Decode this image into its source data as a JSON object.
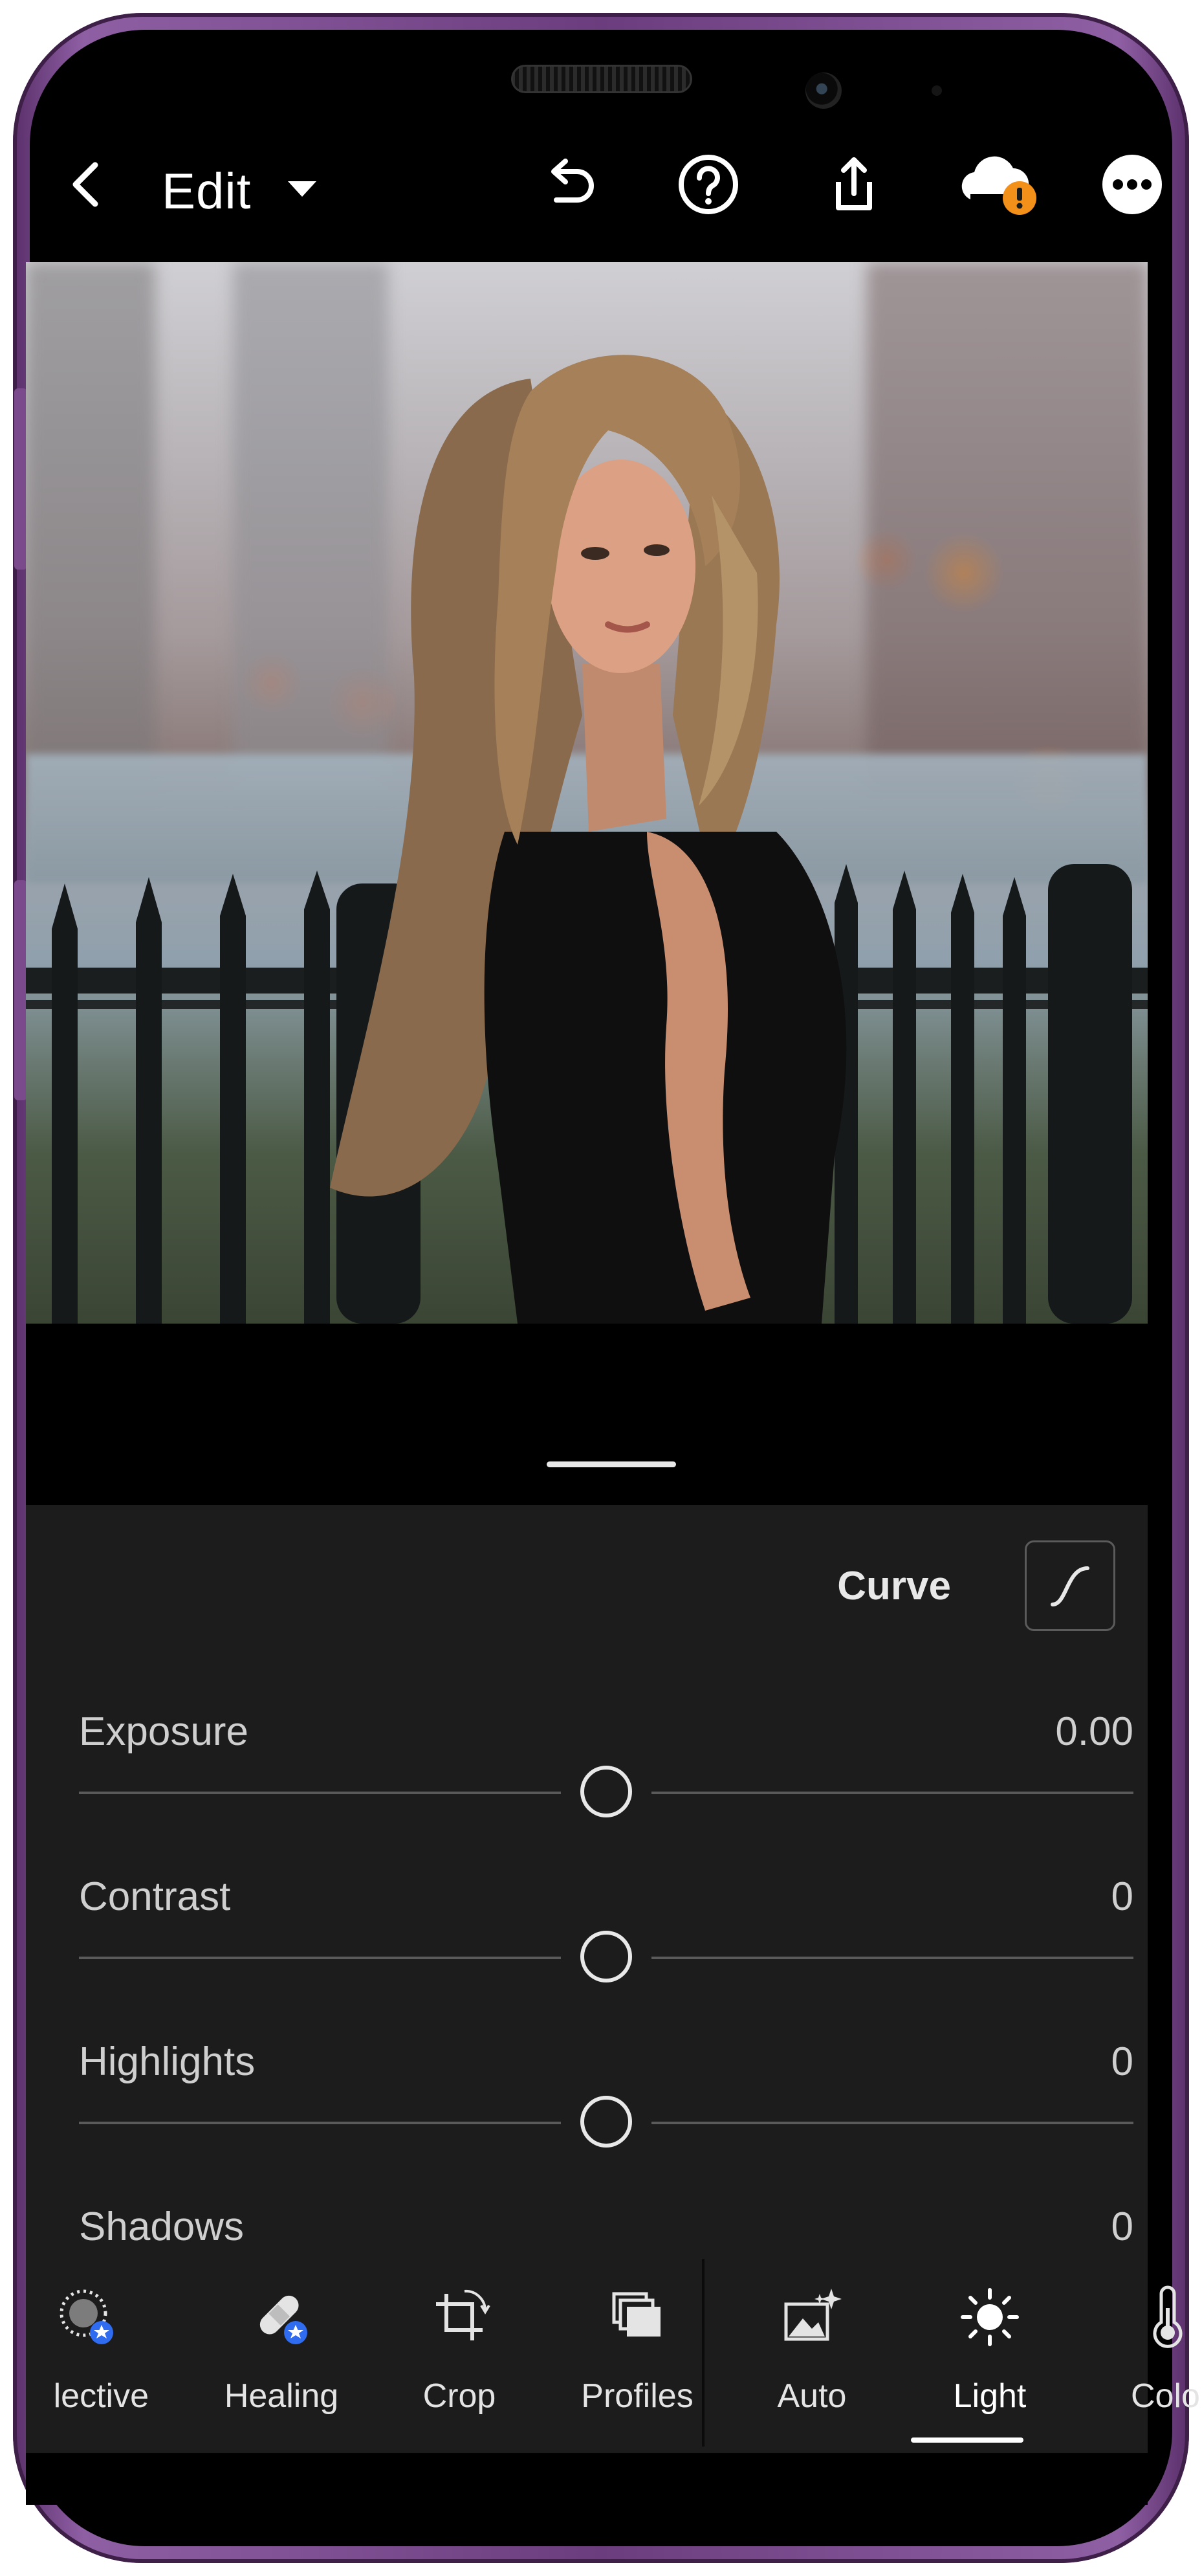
{
  "topbar": {
    "title": "Edit",
    "icons": [
      "back-chevron-icon",
      "caret-down-icon",
      "undo-icon",
      "help-icon",
      "share-icon",
      "cloud-warning-icon",
      "more-icon"
    ]
  },
  "panel": {
    "curve_label": "Curve",
    "sliders": [
      {
        "label": "Exposure",
        "value": "0.00"
      },
      {
        "label": "Contrast",
        "value": "0"
      },
      {
        "label": "Highlights",
        "value": "0"
      },
      {
        "label": "Shadows",
        "value": "0"
      }
    ]
  },
  "toolbar": {
    "tools": [
      {
        "label": "lective",
        "icon": "selective-icon"
      },
      {
        "label": "Healing",
        "icon": "healing-bandage-icon"
      },
      {
        "label": "Crop",
        "icon": "crop-icon"
      },
      {
        "label": "Profiles",
        "icon": "profiles-icon"
      },
      {
        "label": "Auto",
        "icon": "auto-image-icon"
      },
      {
        "label": "Light",
        "icon": "sun-icon"
      },
      {
        "label": "Color",
        "icon": "thermometer-icon"
      }
    ],
    "active": "Light"
  },
  "colors": {
    "frame": "#7a4a8d",
    "panel_bg": "#1c1c1c",
    "badge_orange": "#f29019",
    "badge_blue": "#2f6cf0"
  }
}
